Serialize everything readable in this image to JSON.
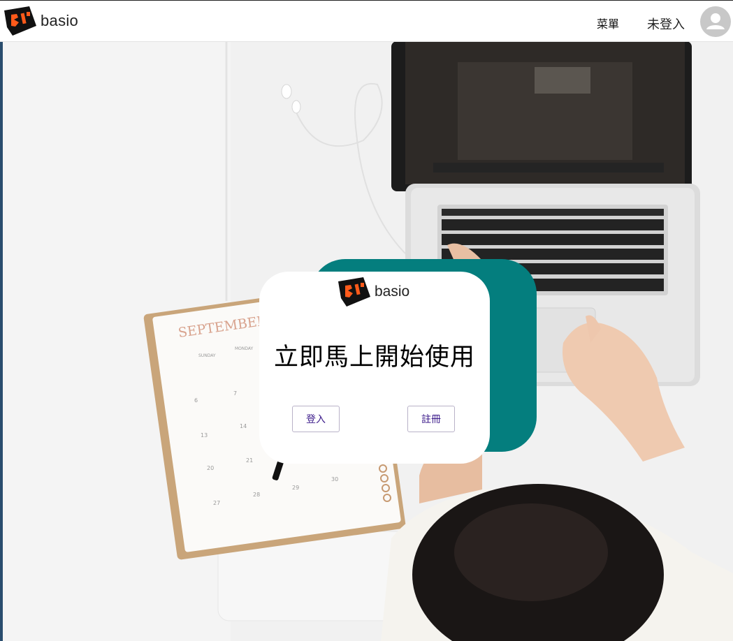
{
  "header": {
    "brand_name": "basio",
    "menu_label": "菜單",
    "login_status": "未登入"
  },
  "hero": {
    "calendar_month": "SEPTEMBER",
    "weekday_1": "SUNDAY",
    "weekday_2": "MONDAY",
    "day_6": "6",
    "day_7": "7",
    "day_13": "13",
    "day_14": "14",
    "day_20": "20",
    "day_21": "21",
    "day_27": "27",
    "day_28": "28",
    "day_29": "29",
    "day_30": "30"
  },
  "card": {
    "brand_name": "basio",
    "title": "立即馬上開始使用",
    "login_button": "登入",
    "register_button": "註冊"
  },
  "colors": {
    "accent_teal": "#047e7e",
    "button_text": "#3b1a8a",
    "logo_black": "#111111",
    "logo_orange": "#ff5a1a"
  }
}
